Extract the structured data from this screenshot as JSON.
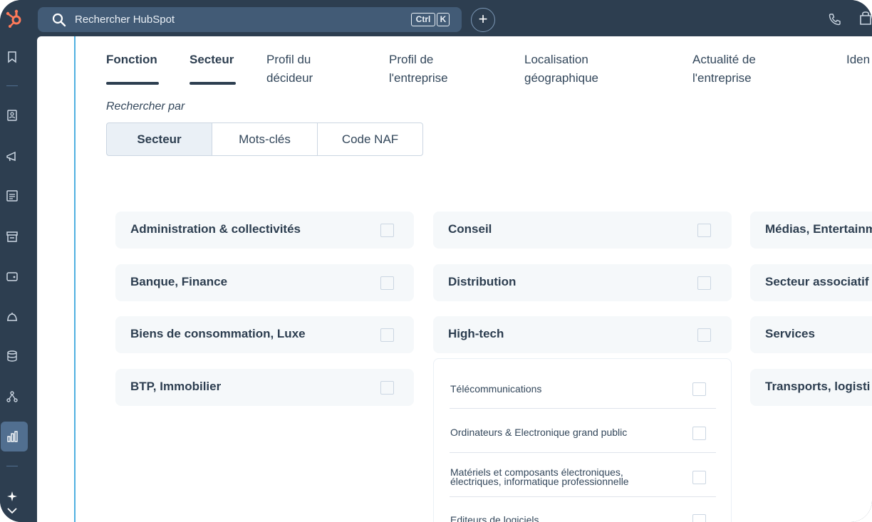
{
  "topbar": {
    "search_placeholder": "Rechercher HubSpot",
    "shortcut_ctrl": "Ctrl",
    "shortcut_key": "K",
    "add_label": "+"
  },
  "tabs": [
    {
      "label": "Fonction",
      "selected": true
    },
    {
      "label": "Secteur",
      "selected": true
    },
    {
      "label": "Profil du\ndécideur"
    },
    {
      "label": "Profil de\nl'entreprise"
    },
    {
      "label": "Localisation\ngéographique"
    },
    {
      "label": "Actualité de\nl'entreprise"
    },
    {
      "label": "Iden"
    }
  ],
  "search_by": {
    "label": "Rechercher par",
    "options": [
      "Secteur",
      "Mots-clés",
      "Code NAF"
    ],
    "selected": "Secteur"
  },
  "sectors": {
    "col1": [
      "Administration & collectivités",
      "Banque, Finance",
      "Biens de consommation, Luxe",
      "BTP, Immobilier"
    ],
    "col2": [
      "Conseil",
      "Distribution",
      "High-tech"
    ],
    "col3": [
      "Médias, Entertainm",
      "Secteur associatif",
      "Services",
      "Transports, logisti"
    ]
  },
  "hightech_sub": [
    "Télécommunications",
    "Ordinateurs & Electronique grand public",
    "Matériels et composants électroniques, électriques, informatique professionnelle",
    "Editeurs de logiciels"
  ],
  "colors": {
    "nav_bg": "#2d3e50",
    "search_bg": "#425b76",
    "accent": "#ff7a59",
    "card_bg": "#f5f8fa",
    "rail_active": "#516f90"
  },
  "rail_icons": [
    "bookmark-icon",
    "contacts-icon",
    "megaphone-icon",
    "content-icon",
    "commerce-icon",
    "wallet-icon",
    "service-icon",
    "database-icon",
    "workflows-icon",
    "reports-icon",
    "sparkle-icon",
    "chevron-down-icon"
  ]
}
